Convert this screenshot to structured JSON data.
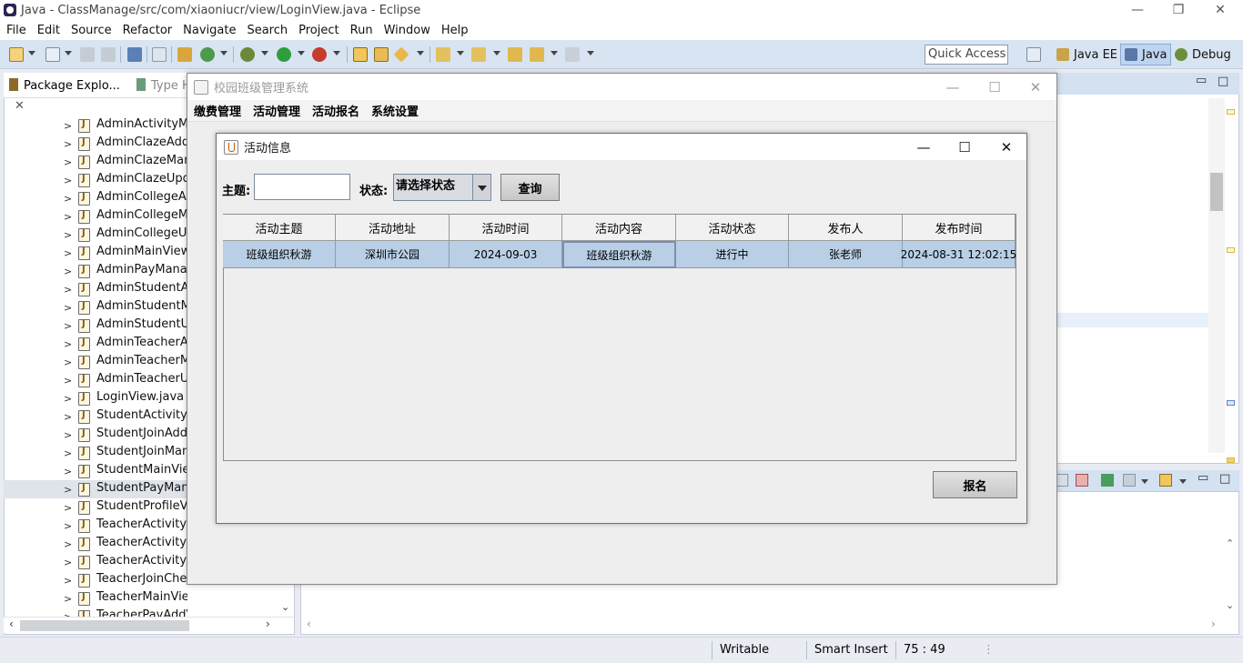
{
  "eclipse": {
    "title": "Java - ClassManage/src/com/xiaoniucr/view/LoginView.java - Eclipse",
    "window_controls": {
      "minimize": "—",
      "restore": "❐",
      "close": "✕"
    },
    "menu": [
      "File",
      "Edit",
      "Source",
      "Refactor",
      "Navigate",
      "Search",
      "Project",
      "Run",
      "Window",
      "Help"
    ],
    "quick_access": "Quick Access",
    "perspectives": [
      "Java EE",
      "Java",
      "Debug"
    ],
    "views": {
      "package_explorer": "Package Explo...",
      "type_hierarchy": "Type H"
    },
    "tree": [
      "AdminActivityMan",
      "AdminClazeAddV",
      "AdminClazeMana",
      "AdminClazeUpda",
      "AdminCollegeAdd",
      "AdminCollegeMa",
      "AdminCollegeUpd",
      "AdminMainView.j",
      "AdminPayManage",
      "AdminStudentAdd",
      "AdminStudentMa",
      "AdminStudentUpd",
      "AdminTeacherAdd",
      "AdminTeacherMa",
      "AdminTeacherUpd",
      "LoginView.java",
      "StudentActivityQu",
      "StudentJoinAddVi",
      "StudentJoinMana",
      "StudentMainView",
      "StudentPayManag",
      "StudentProfileVie",
      "TeacherActivityAd",
      "TeacherActivityMa",
      "TeacherActivityUp",
      "TeacherJoinCheckView.java",
      "TeacherMainView.java",
      "TeacherPayAddView.java"
    ],
    "tree_selected_index": 20,
    "status": {
      "writable": "Writable",
      "insert": "Smart Insert",
      "position": "75 : 49"
    }
  },
  "app": {
    "title": "校园班级管理系统",
    "menu": [
      "缴费管理",
      "活动管理",
      "活动报名",
      "系统设置"
    ]
  },
  "dialog": {
    "title": "活动信息",
    "subject_label": "主题:",
    "subject_value": "",
    "status_label": "状态:",
    "status_selected": "请选择状态",
    "query_button": "查询",
    "signup_button": "报名",
    "table": {
      "columns": [
        "活动主题",
        "活动地址",
        "活动时间",
        "活动内容",
        "活动状态",
        "发布人",
        "发布时间"
      ],
      "rows": [
        [
          "班级组织秋游",
          "深圳市公园",
          "2024-09-03",
          "班级组织秋游",
          "进行中",
          "张老师",
          "2024-08-31 12:02:15"
        ]
      ]
    }
  }
}
